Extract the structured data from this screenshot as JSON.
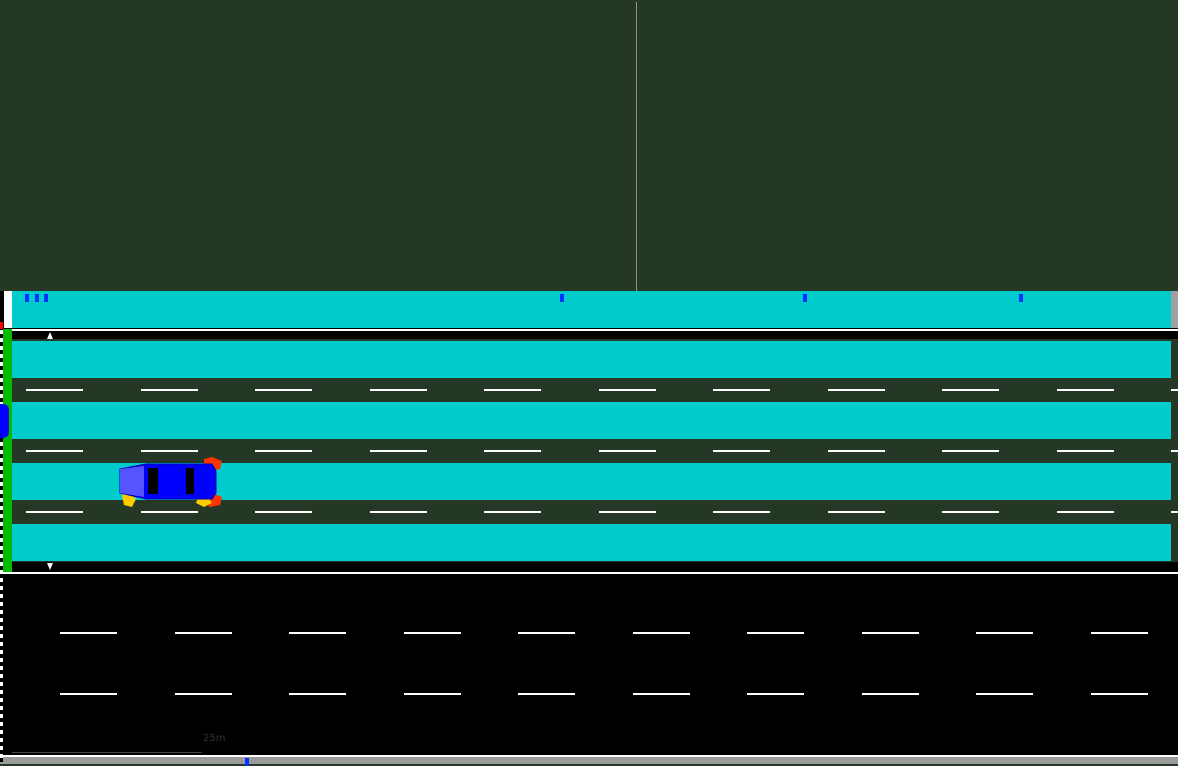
{
  "scene": {
    "scale_label": "25m",
    "colors": {
      "background": "#253826",
      "lane": "#00cccc",
      "road": "#000000",
      "lane_marking": "#ffffff",
      "vehicle": "#0000ff",
      "signal_green": "#00cc00",
      "signal_red": "#ff0000"
    },
    "vehicles": [
      {
        "type": "car",
        "color": "#0000ff",
        "lane": 3
      }
    ]
  }
}
